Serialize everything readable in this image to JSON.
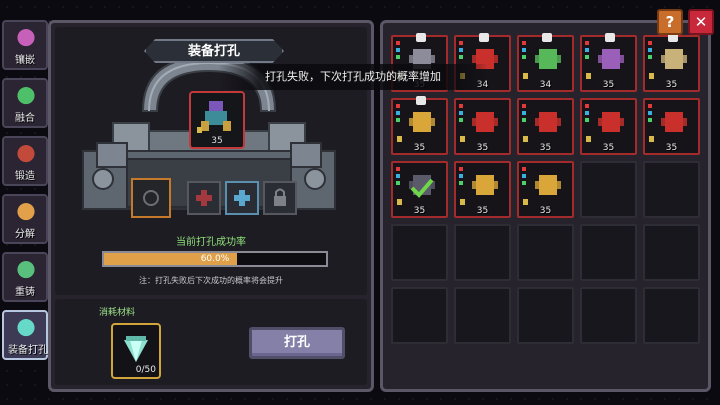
{
  "sidebar": {
    "items": [
      {
        "label": "镶嵌",
        "icon": "gem-socket-icon",
        "color": "#c760b8"
      },
      {
        "label": "融合",
        "icon": "fusion-icon",
        "color": "#4fc06a"
      },
      {
        "label": "锻造",
        "icon": "anvil-icon",
        "color": "#c24a3a"
      },
      {
        "label": "分解",
        "icon": "decompose-icon",
        "color": "#e2a04a"
      },
      {
        "label": "重铸",
        "icon": "recast-icon",
        "color": "#58c07c"
      },
      {
        "label": "装备打孔",
        "icon": "drill-icon",
        "color": "#66d9c8",
        "active": true
      }
    ]
  },
  "machine": {
    "title": "装备打孔",
    "equipped_item_level": "35",
    "holes": [
      "empty-hole",
      "locked-plus",
      "open-plus",
      "locked"
    ]
  },
  "success_rate": {
    "title": "当前打孔成功率",
    "percent_label": "60.0%",
    "fraction": 0.6
  },
  "note": "注：打孔失败后下次成功的概率将会提升",
  "toast": "打孔失败，下次打孔成功的概率增加",
  "cost": {
    "label": "消耗材料",
    "count": "0/50",
    "icon": "crystal-drill-icon"
  },
  "punch_button": "打孔",
  "buttons": {
    "help": "?",
    "close": "✕"
  },
  "inventory": {
    "items": [
      {
        "level": "35",
        "pin": true,
        "icon": "gray-armor-icon"
      },
      {
        "level": "34",
        "pin": true,
        "icon": "red-armor-icon"
      },
      {
        "level": "34",
        "pin": true,
        "icon": "green-ring-icon"
      },
      {
        "level": "35",
        "pin": true,
        "icon": "purple-armor-icon"
      },
      {
        "level": "35",
        "pin": true,
        "icon": "necklace-icon"
      },
      {
        "level": "35",
        "pin": true,
        "icon": "gold-boots-icon"
      },
      {
        "level": "35",
        "pin": false,
        "icon": "red-armor-icon"
      },
      {
        "level": "35",
        "pin": false,
        "icon": "red-armor-icon"
      },
      {
        "level": "35",
        "pin": false,
        "icon": "red-armor-icon"
      },
      {
        "level": "35",
        "pin": false,
        "icon": "red-armor-icon"
      },
      {
        "level": "35",
        "pin": false,
        "icon": "selected-check-icon",
        "selected": true
      },
      {
        "level": "35",
        "pin": false,
        "icon": "gold-boots-icon"
      },
      {
        "level": "35",
        "pin": false,
        "icon": "gold-boots-icon"
      }
    ],
    "total_cells": 25
  }
}
